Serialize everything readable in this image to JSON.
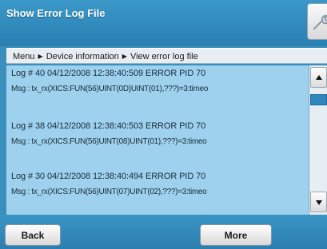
{
  "window": {
    "title": "Show Error Log File",
    "tool_icon": "wrench-icon"
  },
  "breadcrumb": {
    "items": [
      "Menu",
      "Device information",
      "View error log file"
    ]
  },
  "log": {
    "entries": [
      {
        "head": "Log # 40  04/12/2008  12:38:40:509  ERROR  PID  70",
        "msg": "Msg : tx_rx(XICS:FUN(56)UINT(0D)UINT(01),???)=3:timeo"
      },
      {
        "head": "Log # 38  04/12/2008  12:38:40:503  ERROR  PID  70",
        "msg": "Msg : tx_rx(XICS:FUN(56)UINT(08)UINT(01),???)=3:timeo"
      },
      {
        "head": "Log # 30  04/12/2008  12:38:40:494  ERROR  PID  70",
        "msg": "Msg : tx_rx(XICS:FUN(56)UINT(07)UINT(02),???)=3:timeo"
      }
    ]
  },
  "buttons": {
    "back": "Back",
    "more": "More"
  },
  "colors": {
    "titlebar": "#2a7fb1",
    "log_background": "#9dd1ee",
    "scroll_thumb": "#2f86bc"
  }
}
